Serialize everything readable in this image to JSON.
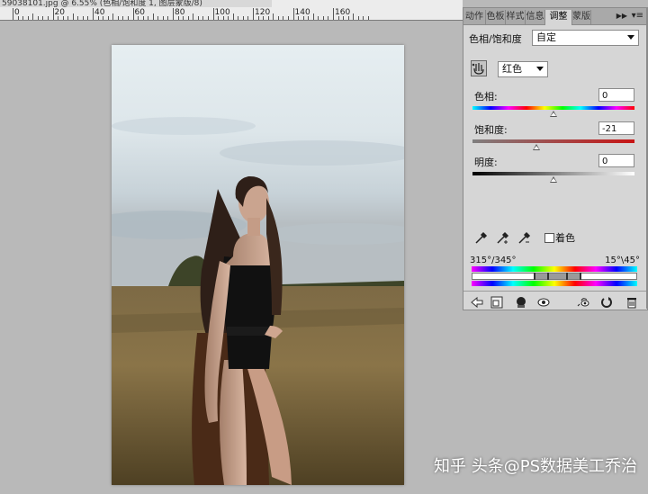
{
  "document": {
    "tab_title": "59038101.jpg @ 6.55% (色相/饱和度 1, 图层蒙版/8)"
  },
  "ruler": {
    "labels": [
      "0",
      "20",
      "40",
      "60",
      "80",
      "100",
      "120",
      "140",
      "160"
    ]
  },
  "panel": {
    "tabs": [
      "动作",
      "色板",
      "样式",
      "信息",
      "调整",
      "蒙版"
    ],
    "active_tab": "调整",
    "title": "色相/饱和度",
    "preset": "自定",
    "channel": "红色",
    "hue_label": "色相:",
    "hue_value": "0",
    "saturation_label": "饱和度:",
    "saturation_value": "-21",
    "lightness_label": "明度:",
    "lightness_value": "0",
    "colorize_label": "着色",
    "range_left": "315°/345°",
    "range_right": "15°\\45°",
    "hue_level": 0,
    "saturation_level": -21,
    "lightness_level": 0,
    "colors": {
      "panel_bg": "#d6d6d6",
      "accent_red": "#c81414"
    }
  },
  "icons": {
    "tab_menu": "panel-menu-icon",
    "eyedropper": "eyedropper-icon",
    "eyedropper_add": "eyedropper-plus-icon",
    "eyedropper_sub": "eyedropper-minus-icon",
    "target": "targeted-adjust-icon",
    "back": "back-arrow-icon",
    "clip": "clip-layer-icon",
    "visibility": "eye-icon",
    "reset": "reset-icon",
    "delete": "trash-icon"
  },
  "watermark": {
    "text": "知乎 头条@PS数据美工乔治"
  }
}
